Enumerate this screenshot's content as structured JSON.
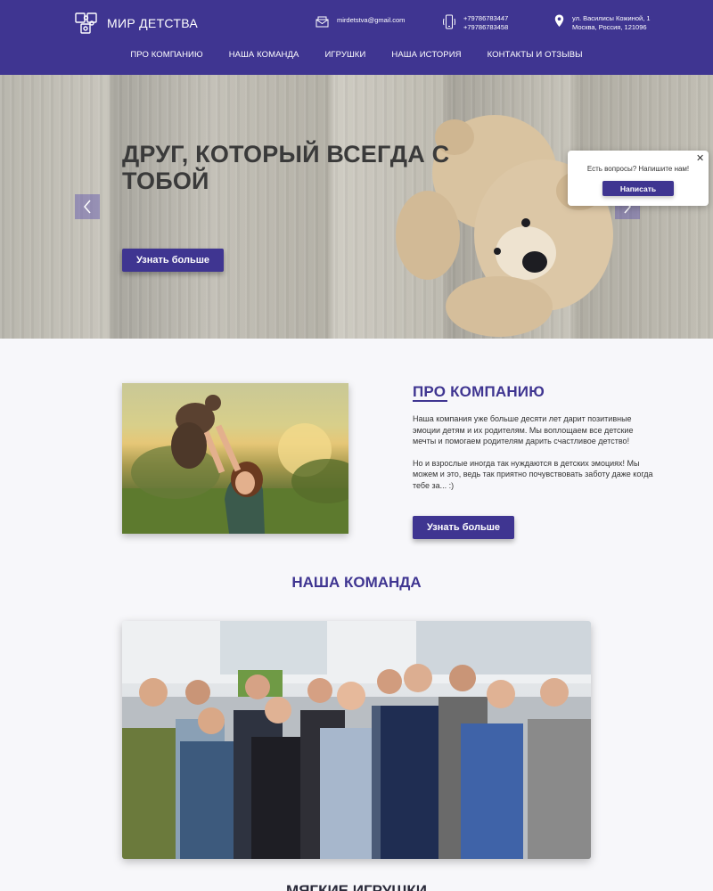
{
  "brand": {
    "name": "МИР ДЕТСТВА"
  },
  "contacts": {
    "email": "mirdetstva@gmail.com",
    "phone_1": "+79786783447",
    "phone_2": "+79786783458",
    "address_line_1": "ул. Василисы Кожиной, 1",
    "address_line_2": "Москва, Россия, 121096"
  },
  "nav": [
    {
      "label": "ПРО КОМПАНИЮ"
    },
    {
      "label": "НАША КОМАНДА"
    },
    {
      "label": "ИГРУШКИ"
    },
    {
      "label": "НАША ИСТОРИЯ"
    },
    {
      "label": "КОНТАКТЫ И ОТЗЫВЫ"
    }
  ],
  "hero": {
    "title": "ДРУГ, КОТОРЫЙ ВСЕГДА С ТОБОЙ",
    "button": "Узнать больше"
  },
  "popup": {
    "text": "Есть вопросы? Напишите нам!",
    "button": "Написать",
    "close": "✕"
  },
  "about": {
    "heading": "ПРО КОМПАНИЮ",
    "paragraph_1": "Наша компания уже больше десяти лет дарит позитивные эмоции детям и их родителям. Мы воплощаем все детские мечты и помогаем родителям дарить счастливое детство!",
    "paragraph_2": "Но и взрослые иногда так нуждаются в детских эмоциях! Мы можем и это, ведь так приятно почувствовать заботу даже когда тебе за... :)",
    "button": "Узнать больше"
  },
  "team": {
    "heading": "НАША КОМАНДА"
  },
  "next_section": {
    "heading": "МЯГКИЕ ИГРУШКИ"
  },
  "colors": {
    "brand": "#3f3591",
    "page_background": "#f7f7fa"
  }
}
